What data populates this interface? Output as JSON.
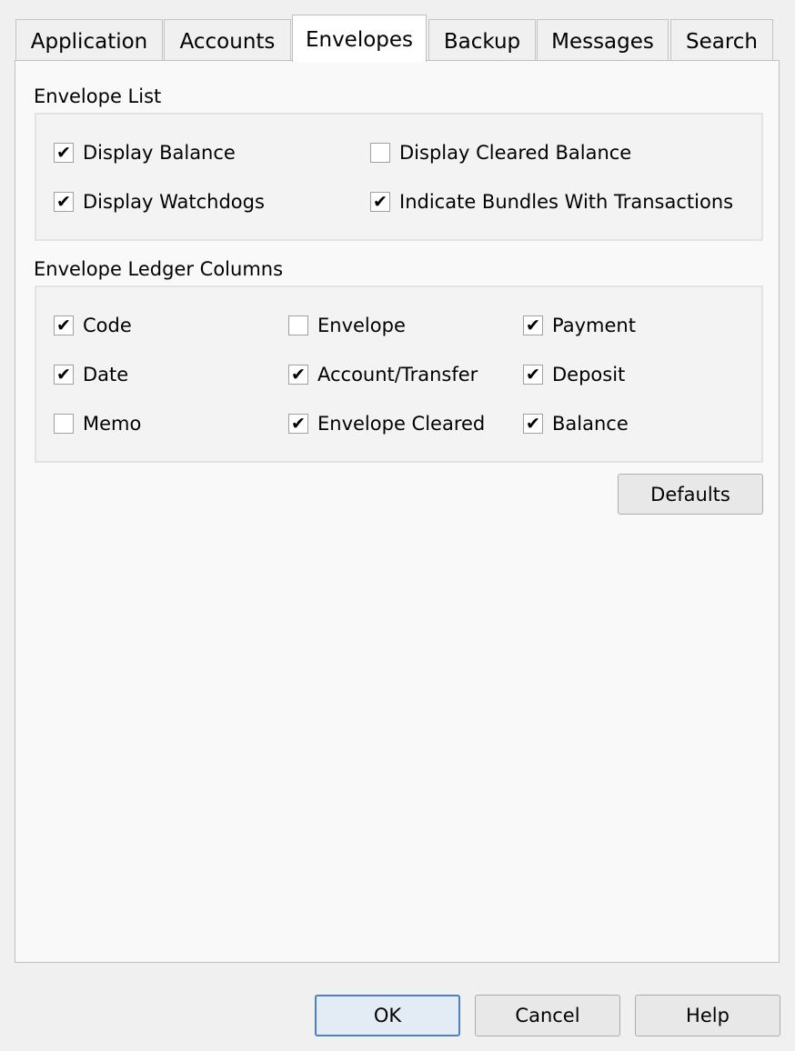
{
  "tabs": [
    {
      "label": "Application",
      "active": false
    },
    {
      "label": "Accounts",
      "active": false
    },
    {
      "label": "Envelopes",
      "active": true
    },
    {
      "label": "Backup",
      "active": false
    },
    {
      "label": "Messages",
      "active": false
    },
    {
      "label": "Search",
      "active": false
    }
  ],
  "envelope_list": {
    "title": "Envelope List",
    "options": [
      {
        "label": "Display Balance",
        "checked": true
      },
      {
        "label": "Display Cleared Balance",
        "checked": false
      },
      {
        "label": "Display Watchdogs",
        "checked": true
      },
      {
        "label": "Indicate Bundles With Transactions",
        "checked": true
      }
    ]
  },
  "ledger_columns": {
    "title": "Envelope Ledger Columns",
    "options": [
      {
        "label": "Code",
        "checked": true
      },
      {
        "label": "Envelope",
        "checked": false
      },
      {
        "label": "Payment",
        "checked": true
      },
      {
        "label": "Date",
        "checked": true
      },
      {
        "label": "Account/Transfer",
        "checked": true
      },
      {
        "label": "Deposit",
        "checked": true
      },
      {
        "label": "Memo",
        "checked": false
      },
      {
        "label": "Envelope Cleared",
        "checked": true
      },
      {
        "label": "Balance",
        "checked": true
      }
    ]
  },
  "defaults_label": "Defaults",
  "footer": {
    "ok_label": "OK",
    "cancel_label": "Cancel",
    "help_label": "Help"
  },
  "check_glyph": "✔"
}
